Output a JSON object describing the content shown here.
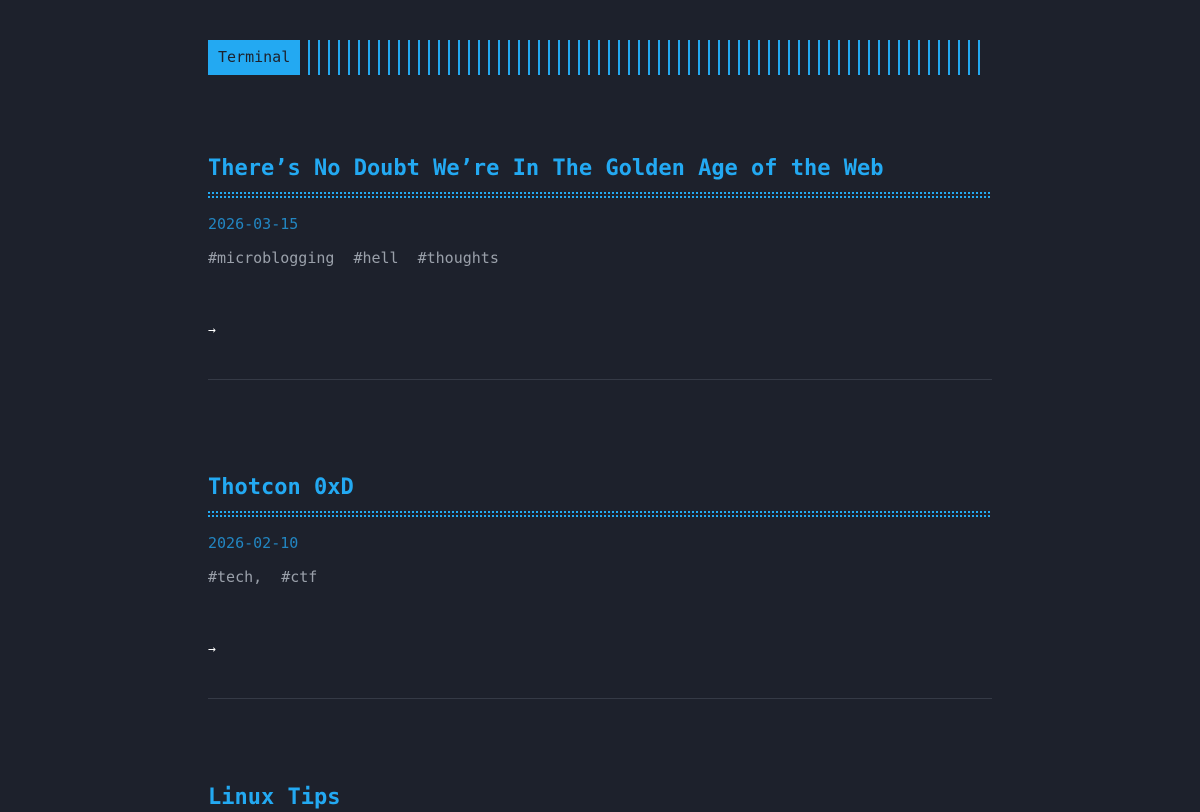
{
  "header": {
    "logo_text": "Terminal"
  },
  "posts": [
    {
      "title": "There’s No Doubt We’re In The Golden Age of the Web",
      "date": "2026-03-15",
      "tags": [
        "#microblogging",
        "#hell",
        "#thoughts"
      ],
      "read_more_arrow": "→"
    },
    {
      "title": "Thotcon 0xD",
      "date": "2026-02-10",
      "tags": [
        "#tech,",
        "#ctf"
      ],
      "read_more_arrow": "→"
    },
    {
      "title": "Linux Tips"
    }
  ],
  "colors": {
    "background": "#1d212c",
    "accent": "#23a9f2",
    "date": "#2286c2",
    "tags": "#9aa0aa",
    "divider": "#353a46"
  }
}
